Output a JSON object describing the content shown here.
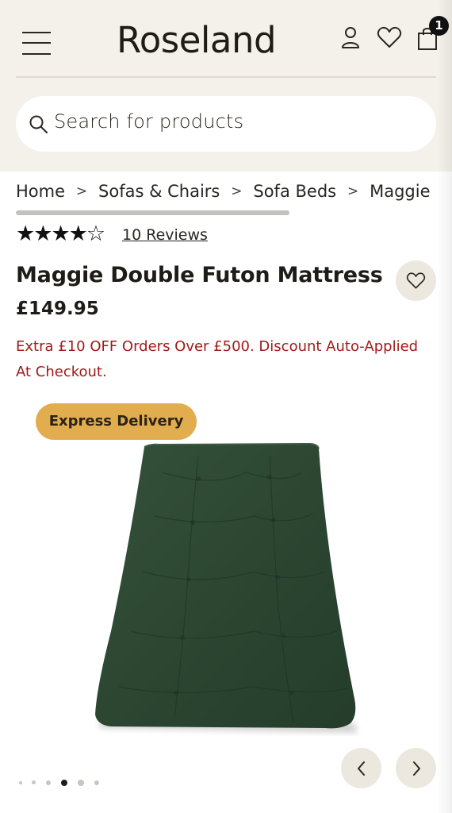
{
  "header": {
    "logo": "Roseland",
    "cart_count": "1",
    "icons": [
      "hamburger-menu-icon",
      "account-icon",
      "wishlist-heart-icon",
      "shopping-bag-icon"
    ]
  },
  "search": {
    "placeholder": "Search for products"
  },
  "breadcrumb": {
    "items": [
      "Home",
      "Sofas & Chairs",
      "Sofa Beds",
      "Maggie Double Futon Mattress"
    ],
    "separator": ">"
  },
  "rating": {
    "stars_filled": 4,
    "stars_total": 5,
    "reviews_label": "10 Reviews"
  },
  "product": {
    "title": "Maggie Double Futon Mattress",
    "price": "£149.95",
    "promo": "Extra £10 OFF Orders Over £500. Discount Auto-Applied At Checkout.",
    "badge": "Express Delivery",
    "image_icon": "green-futon-mattress-image"
  },
  "gallery": {
    "total_images": 6,
    "active_index": 4,
    "prev_icon": "chevron-left-icon",
    "next_icon": "chevron-right-icon"
  },
  "colors": {
    "header_bg": "#f4f1ea",
    "promo_text": "#a11a1a",
    "badge_bg": "#e2ad4f",
    "mattress": "#2f4a34"
  }
}
